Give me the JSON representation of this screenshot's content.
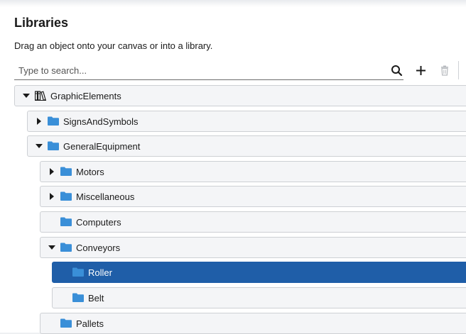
{
  "header": {
    "title": "Libraries",
    "subtitle": "Drag an object onto your canvas or into a library."
  },
  "search": {
    "placeholder": "Type to search...",
    "value": ""
  },
  "toolbar": {
    "icons": [
      "search-icon",
      "add-icon",
      "delete-icon"
    ]
  },
  "colors": {
    "folder": "#3a8fd8",
    "selected_background": "#1f5ea8",
    "row_background": "#f4f5f7"
  },
  "tree": {
    "items": [
      {
        "label": "GraphicElements",
        "state": "expanded",
        "icon": "library-icon"
      },
      {
        "label": "SignsAndSymbols",
        "state": "collapsed",
        "icon": "folder-icon"
      },
      {
        "label": "GeneralEquipment",
        "state": "expanded",
        "icon": "folder-icon"
      },
      {
        "label": "Motors",
        "state": "collapsed",
        "icon": "folder-icon"
      },
      {
        "label": "Miscellaneous",
        "state": "collapsed",
        "icon": "folder-icon"
      },
      {
        "label": "Computers",
        "state": "leaf",
        "icon": "folder-icon"
      },
      {
        "label": "Conveyors",
        "state": "expanded",
        "icon": "folder-icon"
      },
      {
        "label": "Roller",
        "state": "leaf",
        "icon": "folder-icon",
        "selected": true
      },
      {
        "label": "Belt",
        "state": "leaf",
        "icon": "folder-icon"
      },
      {
        "label": "Pallets",
        "state": "leaf",
        "icon": "folder-icon"
      }
    ]
  }
}
